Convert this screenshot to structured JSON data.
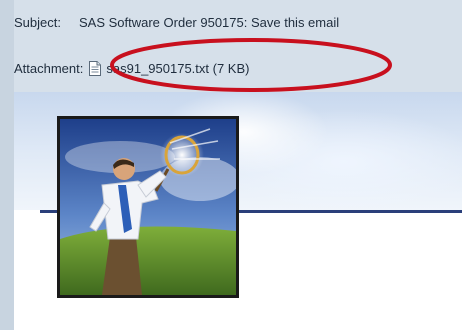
{
  "header": {
    "subject_label": "Subject:",
    "subject_value": "SAS Software Order 950175: Save this email",
    "attachment_label": "Attachment:",
    "attachment_file": "sas91_950175.txt (7 KB)"
  },
  "icons": {
    "attachment": "text-file-icon"
  },
  "colors": {
    "header_bg": "#d6e0ea",
    "annotation": "#c8101e",
    "rule": "#2a3f7a"
  }
}
